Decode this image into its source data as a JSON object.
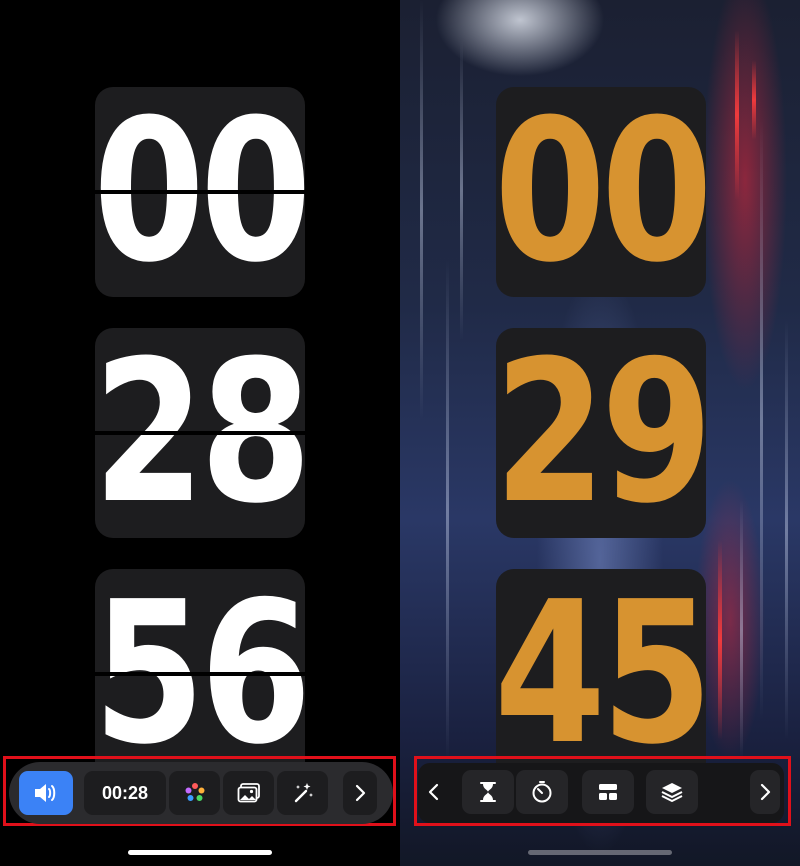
{
  "left_screen": {
    "hours": "00",
    "minutes": "28",
    "seconds": "56",
    "digit_color": "#ffffff",
    "toolbar": {
      "sound_icon": "speaker-icon",
      "time_label": "00:28",
      "color_icon": "palette-icon",
      "background_icon": "image-icon",
      "effects_icon": "magic-wand-icon",
      "next_icon": "chevron-right-icon",
      "active_color": "#3b82f6"
    }
  },
  "right_screen": {
    "hours": "00",
    "minutes": "29",
    "seconds": "45",
    "digit_color": "#d79330",
    "toolbar": {
      "prev_icon": "chevron-left-icon",
      "timer_icon": "hourglass-icon",
      "stopwatch_icon": "stopwatch-icon",
      "layout_icon": "layout-icon",
      "layers_icon": "layers-icon",
      "next_icon": "chevron-right-icon"
    }
  },
  "highlight_color": "#e0101a"
}
